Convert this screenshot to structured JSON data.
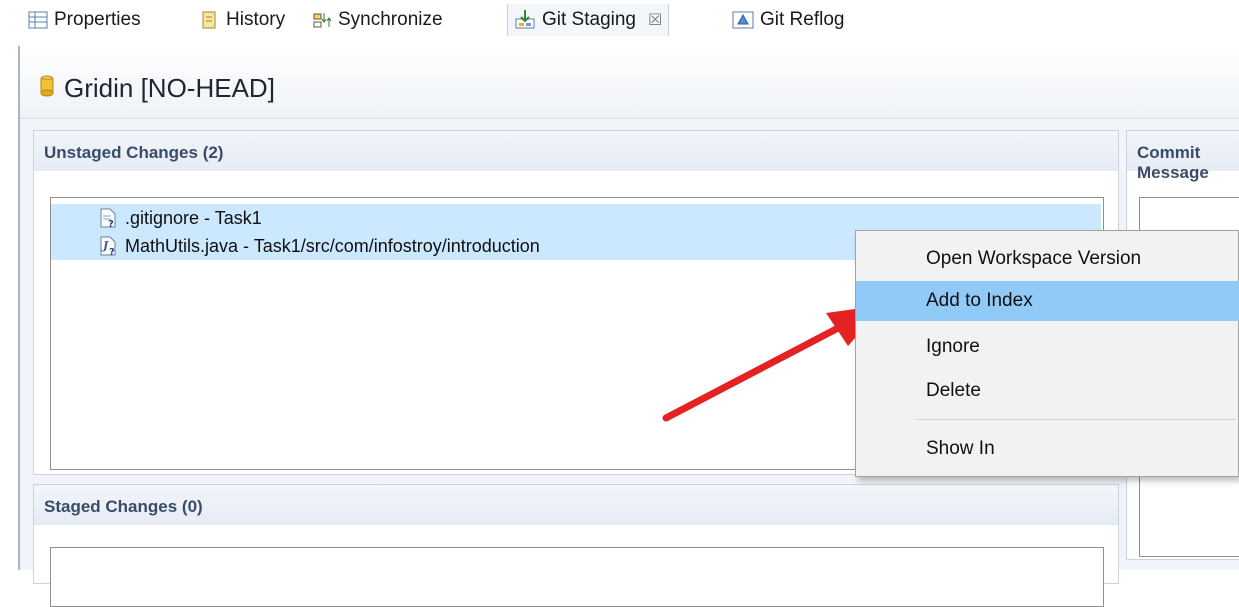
{
  "tabs": [
    {
      "label": "Properties",
      "icon": "properties-icon"
    },
    {
      "label": "History",
      "icon": "history-icon"
    },
    {
      "label": "Synchronize",
      "icon": "synchronize-icon"
    },
    {
      "label": "Git Staging",
      "icon": "git-staging-icon",
      "active": true
    },
    {
      "label": "Git Reflog",
      "icon": "git-reflog-icon"
    }
  ],
  "tab_close_glyph": "☒",
  "repository": {
    "title": "Gridin [NO-HEAD]",
    "icon": "repository-icon"
  },
  "unstaged": {
    "title": "Unstaged Changes (2)",
    "files": [
      {
        "label": ".gitignore - Task1",
        "icon": "untracked-file-icon"
      },
      {
        "label": "MathUtils.java - Task1/src/com/infostroy/introduction",
        "icon": "untracked-java-file-icon"
      }
    ]
  },
  "staged": {
    "title": "Staged Changes (0)",
    "files": []
  },
  "commit": {
    "title": "Commit Message"
  },
  "context_menu": {
    "items": [
      "Open Workspace Version",
      "Add to Index",
      "Ignore",
      "Delete",
      "Show In"
    ],
    "highlighted": "Add to Index"
  },
  "colors": {
    "selection": "#cce8ff",
    "menu_highlight": "#91c9f7",
    "arrow": "#e52222",
    "section_title": "#3a4c68"
  }
}
